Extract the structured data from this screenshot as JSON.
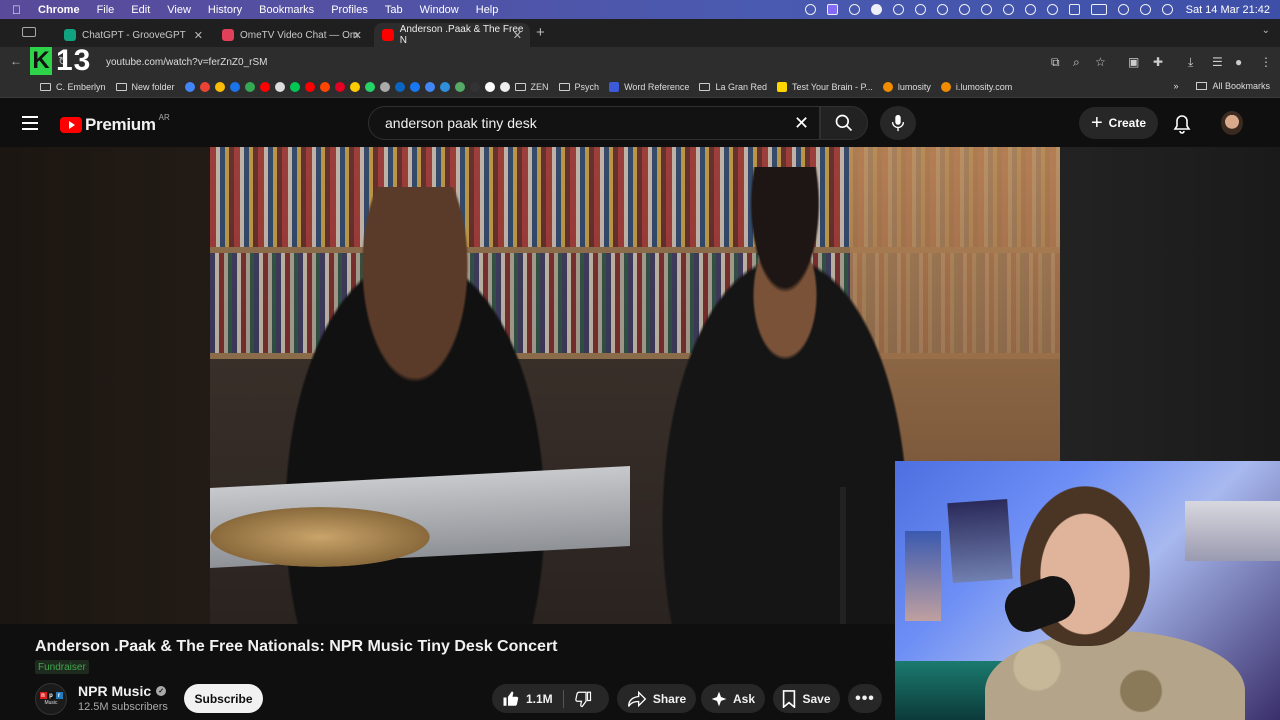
{
  "menubar": {
    "app_name": "Chrome",
    "items": [
      "File",
      "Edit",
      "View",
      "History",
      "Bookmarks",
      "Profiles",
      "Tab",
      "Window",
      "Help"
    ],
    "clock": "Sat 14 Mar  21:42"
  },
  "tabs": [
    {
      "title": "ChatGPT - GrooveGPT",
      "favicon_color": "#10a37f",
      "active": false
    },
    {
      "title": "OmeTV Video Chat — Om",
      "favicon_color": "#e0405a",
      "active": false
    },
    {
      "title": "Anderson .Paak & The Free N",
      "favicon_color": "#ff0000",
      "active": true
    }
  ],
  "address_bar": {
    "url": "youtube.com/watch?v=ferZnZ0_rSM"
  },
  "overlay_logo": {
    "letter": "K",
    "number": "13"
  },
  "bookmarks": {
    "items": [
      {
        "label": "C. Emberlyn",
        "type": "folder"
      },
      {
        "label": "New folder",
        "type": "folder"
      },
      {
        "label": "ZEN",
        "type": "folder"
      },
      {
        "label": "Psych",
        "type": "folder"
      },
      {
        "label": "Word Reference",
        "type": "site"
      },
      {
        "label": "La Gran Red",
        "type": "folder"
      },
      {
        "label": "Test Your Brain - P...",
        "type": "site"
      },
      {
        "label": "lumosity",
        "type": "site"
      },
      {
        "label": "i.lumosity.com",
        "type": "site"
      }
    ],
    "icon_only_colors": [
      "#4285f4",
      "#ea4335",
      "#fbbc05",
      "#34a853",
      "#ff0000",
      "#00c853",
      "#1877f2",
      "#e60023",
      "#ff9900",
      "#25d366",
      "#0a66c2",
      "#ffffff",
      "#ffcc00"
    ],
    "all_bookmarks": "All Bookmarks"
  },
  "youtube": {
    "logo_text": "Premium",
    "country_code": "AR",
    "search_query": "anderson paak tiny desk",
    "create_label": "Create"
  },
  "video": {
    "title": "Anderson .Paak & The Free Nationals: NPR Music Tiny Desk Concert",
    "badge": "Fundraiser",
    "channel_name": "NPR Music",
    "subscribers": "12.5M subscribers",
    "channel_avatar_letters": [
      "n",
      "p",
      "r"
    ],
    "channel_avatar_sub": "Music",
    "subscribe_label": "Subscribe",
    "likes": "1.1M",
    "share_label": "Share",
    "ask_label": "Ask",
    "save_label": "Save"
  },
  "colors": {
    "yt_red": "#ff0000",
    "background": "#0f0f0f",
    "pill": "#272727",
    "fundraiser_green": "#3ea64b"
  }
}
